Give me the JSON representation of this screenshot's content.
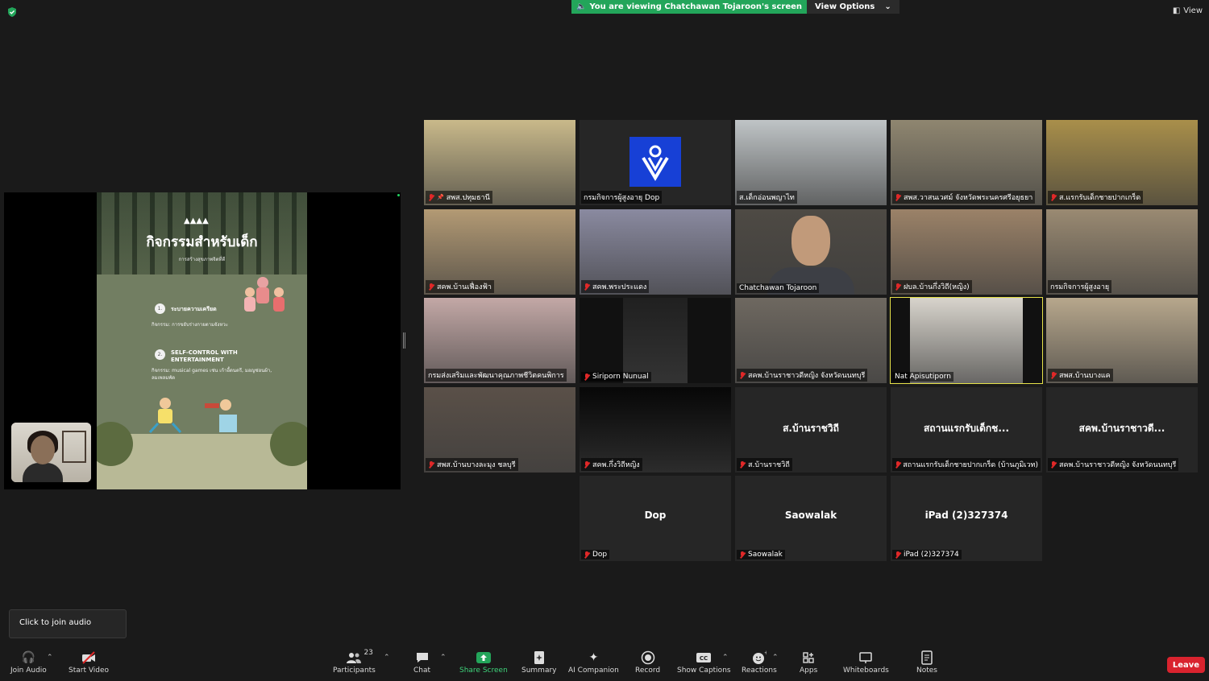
{
  "top": {
    "viewing_banner": "You are viewing Chatchawan Tojaroon's screen",
    "view_options": "View Options",
    "view": "View"
  },
  "slide": {
    "title": "กิจกรรมสำหรับเด็ก",
    "subtitle": "การสร้างสุขภาพจิตที่ดี",
    "items": [
      {
        "num": "1.",
        "heading": "ระบายความเครียด",
        "text": "กิจกรรม: การขยับร่างกายตามจังหวะ"
      },
      {
        "num": "2.",
        "heading": "SELF-CONTROL WITH ENTERTAINMENT",
        "text": "กิจกรรม: musical games เช่น เก้าอี้ดนตรี, มอญซ่อนผ้า, ลมเพลมพัด"
      }
    ]
  },
  "tiles": [
    {
      "name": "สพส.ปทุมธานี",
      "muted": true,
      "pinned": true
    },
    {
      "name": "กรมกิจการผู้สูงอายุ Dop",
      "muted": false
    },
    {
      "name": "ส.เด็กอ่อนพญาไท",
      "muted": false
    },
    {
      "name": "สพส.วาสนเวศม์ จังหวัดพระนครศรีอยุธยา",
      "muted": true
    },
    {
      "name": "ส.แรกรับเด็กชายปากเกร็ด",
      "muted": true
    },
    {
      "name": "สคพ.บ้านเฟื่องฟ้า",
      "muted": true
    },
    {
      "name": "สคพ.พระประแดง",
      "muted": true
    },
    {
      "name": "Chatchawan Tojaroon",
      "muted": false
    },
    {
      "name": "ฝบล.บ้านกึ่งวิถี(หญิง)",
      "muted": true
    },
    {
      "name": "กรมกิจการผู้สูงอายุ",
      "muted": false
    },
    {
      "name": "กรมส่งเสริมและพัฒนาคุณภาพชีวิตคนพิการ",
      "muted": false
    },
    {
      "name": "Siriporn Nunual",
      "muted": true
    },
    {
      "name": "สคพ.บ้านราชาวดีหญิง จังหวัดนนทบุรี",
      "muted": true
    },
    {
      "name": "Nat Apisutiporn",
      "muted": false
    },
    {
      "name": "สพส.บ้านบางแค",
      "muted": true
    },
    {
      "name": "สพส.บ้านบางละมุง ชลบุรี",
      "muted": true
    },
    {
      "name": "สคพ.กึ่งวิถีหญิง",
      "muted": true
    },
    {
      "name": "ส.บ้านราชวิถี",
      "muted": true,
      "big": "ส.บ้านราชวิถี"
    },
    {
      "name": "สถานแรกรับเด็กชายปากเกร็ด (บ้านภูมิเวท)",
      "muted": true,
      "big": "สถานแรกรับเด็กช..."
    },
    {
      "name": "สคพ.บ้านราชาวดีหญิง จังหวัดนนทบุรี",
      "muted": true,
      "big": "สคพ.บ้านราชาวดี..."
    },
    {
      "name": "Dop",
      "muted": true,
      "big": "Dop"
    },
    {
      "name": "Saowalak",
      "muted": true,
      "big": "Saowalak"
    },
    {
      "name": "iPad (2)327374",
      "muted": true,
      "big": "iPad (2)327374"
    }
  ],
  "audio_tip": "Click to join audio",
  "toolbar": {
    "join_audio": "Join Audio",
    "start_video": "Start Video",
    "participants": "Participants",
    "participants_count": "23",
    "chat": "Chat",
    "share_screen": "Share Screen",
    "summary": "Summary",
    "ai_companion": "AI Companion",
    "record": "Record",
    "show_captions": "Show Captions",
    "reactions": "Reactions",
    "apps": "Apps",
    "whiteboards": "Whiteboards",
    "notes": "Notes",
    "leave": "Leave"
  }
}
